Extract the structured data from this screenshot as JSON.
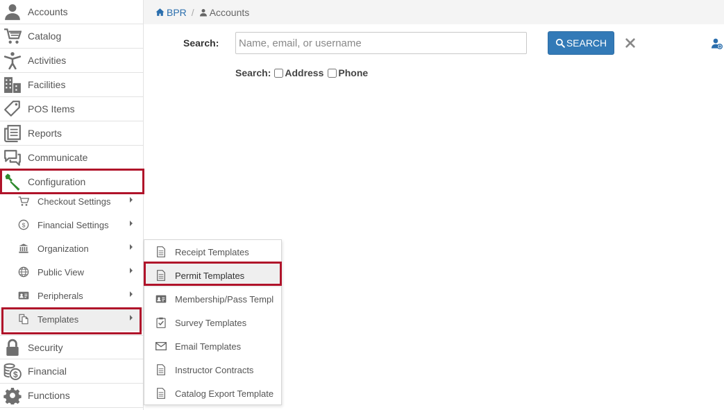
{
  "sidebar": {
    "items": [
      {
        "label": "Accounts",
        "icon": "user-icon"
      },
      {
        "label": "Catalog",
        "icon": "cart-icon"
      },
      {
        "label": "Activities",
        "icon": "person-activity-icon"
      },
      {
        "label": "Facilities",
        "icon": "building-icon"
      },
      {
        "label": "POS Items",
        "icon": "tag-icon"
      },
      {
        "label": "Reports",
        "icon": "reports-icon"
      },
      {
        "label": "Communicate",
        "icon": "chat-icon"
      },
      {
        "label": "Configuration",
        "icon": "wrench-icon"
      }
    ],
    "config_subitems": [
      {
        "label": "Checkout Settings",
        "icon": "cart-icon"
      },
      {
        "label": "Financial Settings",
        "icon": "dollar-circle-icon"
      },
      {
        "label": "Organization",
        "icon": "bank-icon"
      },
      {
        "label": "Public View",
        "icon": "globe-icon"
      },
      {
        "label": "Peripherals",
        "icon": "id-card-icon"
      },
      {
        "label": "Templates",
        "icon": "copy-icon"
      }
    ],
    "bottom_items": [
      {
        "label": "Security",
        "icon": "lock-icon"
      },
      {
        "label": "Financial",
        "icon": "coins-icon"
      },
      {
        "label": "Functions",
        "icon": "gear-icon"
      }
    ]
  },
  "breadcrumb": {
    "home": "BPR",
    "separator": "/",
    "current": "Accounts"
  },
  "search": {
    "label": "Search:",
    "placeholder": "Name, email, or username",
    "value": "",
    "button_label": "SEARCH",
    "options_label": "Search:",
    "options": [
      {
        "label": "Address",
        "checked": false
      },
      {
        "label": "Phone",
        "checked": false
      }
    ]
  },
  "flyout": {
    "items": [
      {
        "label": "Receipt Templates",
        "icon": "document-icon"
      },
      {
        "label": "Permit Templates",
        "icon": "document-icon"
      },
      {
        "label": "Membership/Pass Templ...",
        "icon": "id-card-icon"
      },
      {
        "label": "Survey Templates",
        "icon": "checklist-icon"
      },
      {
        "label": "Email Templates",
        "icon": "envelope-icon"
      },
      {
        "label": "Instructor Contracts",
        "icon": "document-icon"
      },
      {
        "label": "Catalog Export Templates",
        "icon": "document-icon"
      }
    ]
  },
  "colors": {
    "accent": "#337ab7",
    "link": "#2a6ead",
    "highlight": "#b0132a",
    "config_icon": "#2f8a2f"
  }
}
